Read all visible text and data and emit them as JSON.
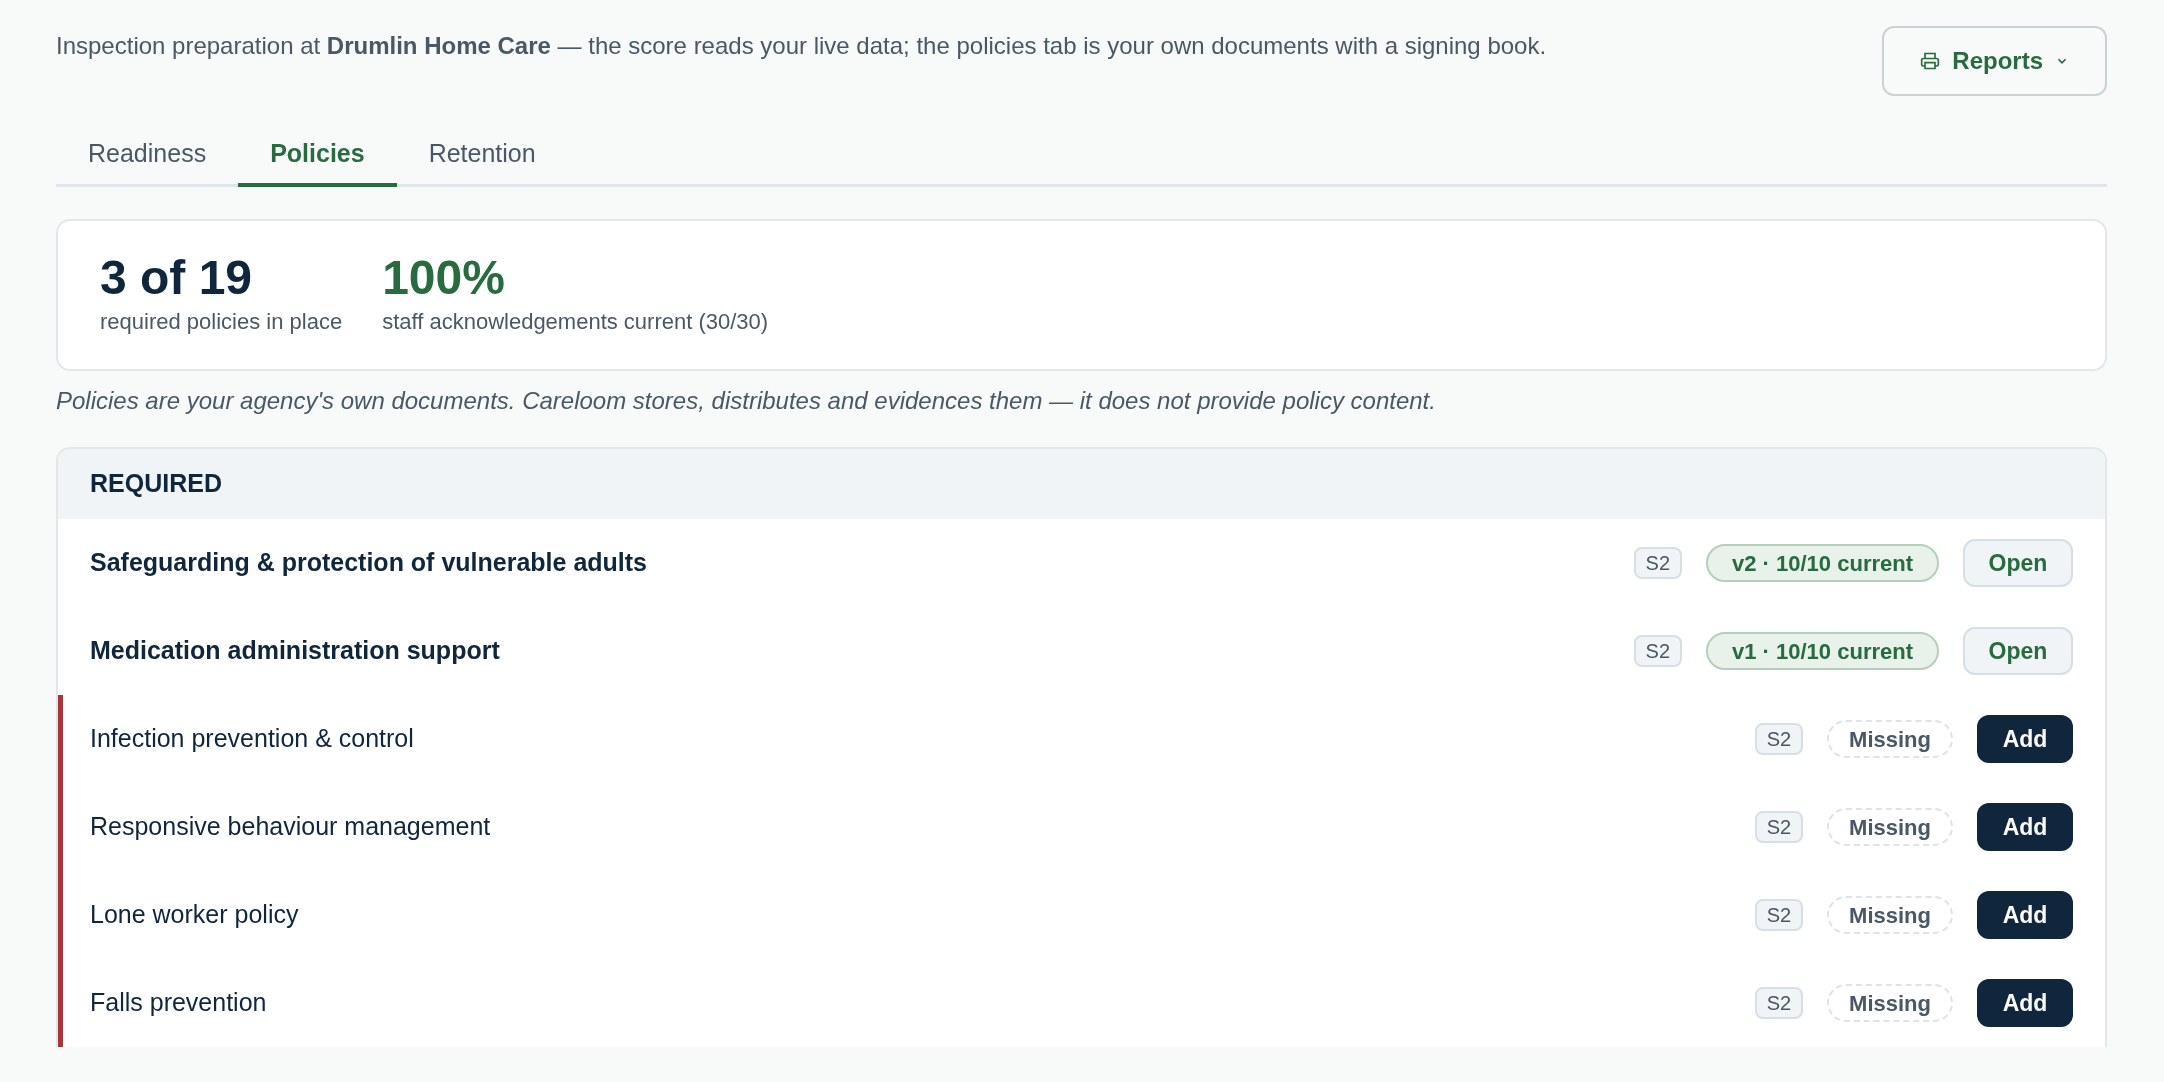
{
  "intro": "Inspection preparation at **Drumlin Home Care** — the score reads your live data; the policies tab is your own documents with a signing book.",
  "reports_button": {
    "label": "Reports"
  },
  "tabs": [
    {
      "label": "Readiness",
      "selected": false
    },
    {
      "label": "Policies",
      "selected": true
    },
    {
      "label": "Retention",
      "selected": false
    }
  ],
  "stats": [
    {
      "value": "3 of 19",
      "caption": "required policies in place",
      "kind": "count"
    },
    {
      "value": "100%",
      "caption": "staff acknowledgements current (30/30)",
      "kind": "percent"
    }
  ],
  "note": "Policies are your agency's own documents. Careloom stores, distributes and evidences them — it does not provide policy content.",
  "section": {
    "title": "REQUIRED",
    "rows": [
      {
        "title": "Safeguarding & protection of vulnerable adults",
        "tag": "S2",
        "status": "v2 · 10/10 current",
        "action": "Open",
        "kind": "present"
      },
      {
        "title": "Medication administration support",
        "tag": "S2",
        "status": "v1 · 10/10 current",
        "action": "Open",
        "kind": "present"
      },
      {
        "title": "Infection prevention & control",
        "tag": "S2",
        "status": "Missing",
        "action": "Add",
        "kind": "missing"
      },
      {
        "title": "Responsive behaviour management",
        "tag": "S2",
        "status": "Missing",
        "action": "Add",
        "kind": "missing"
      },
      {
        "title": "Lone worker policy",
        "tag": "S2",
        "status": "Missing",
        "action": "Add",
        "kind": "missing"
      },
      {
        "title": "Falls prevention",
        "tag": "S2",
        "status": "Missing",
        "action": "Add",
        "kind": "missing"
      }
    ]
  }
}
